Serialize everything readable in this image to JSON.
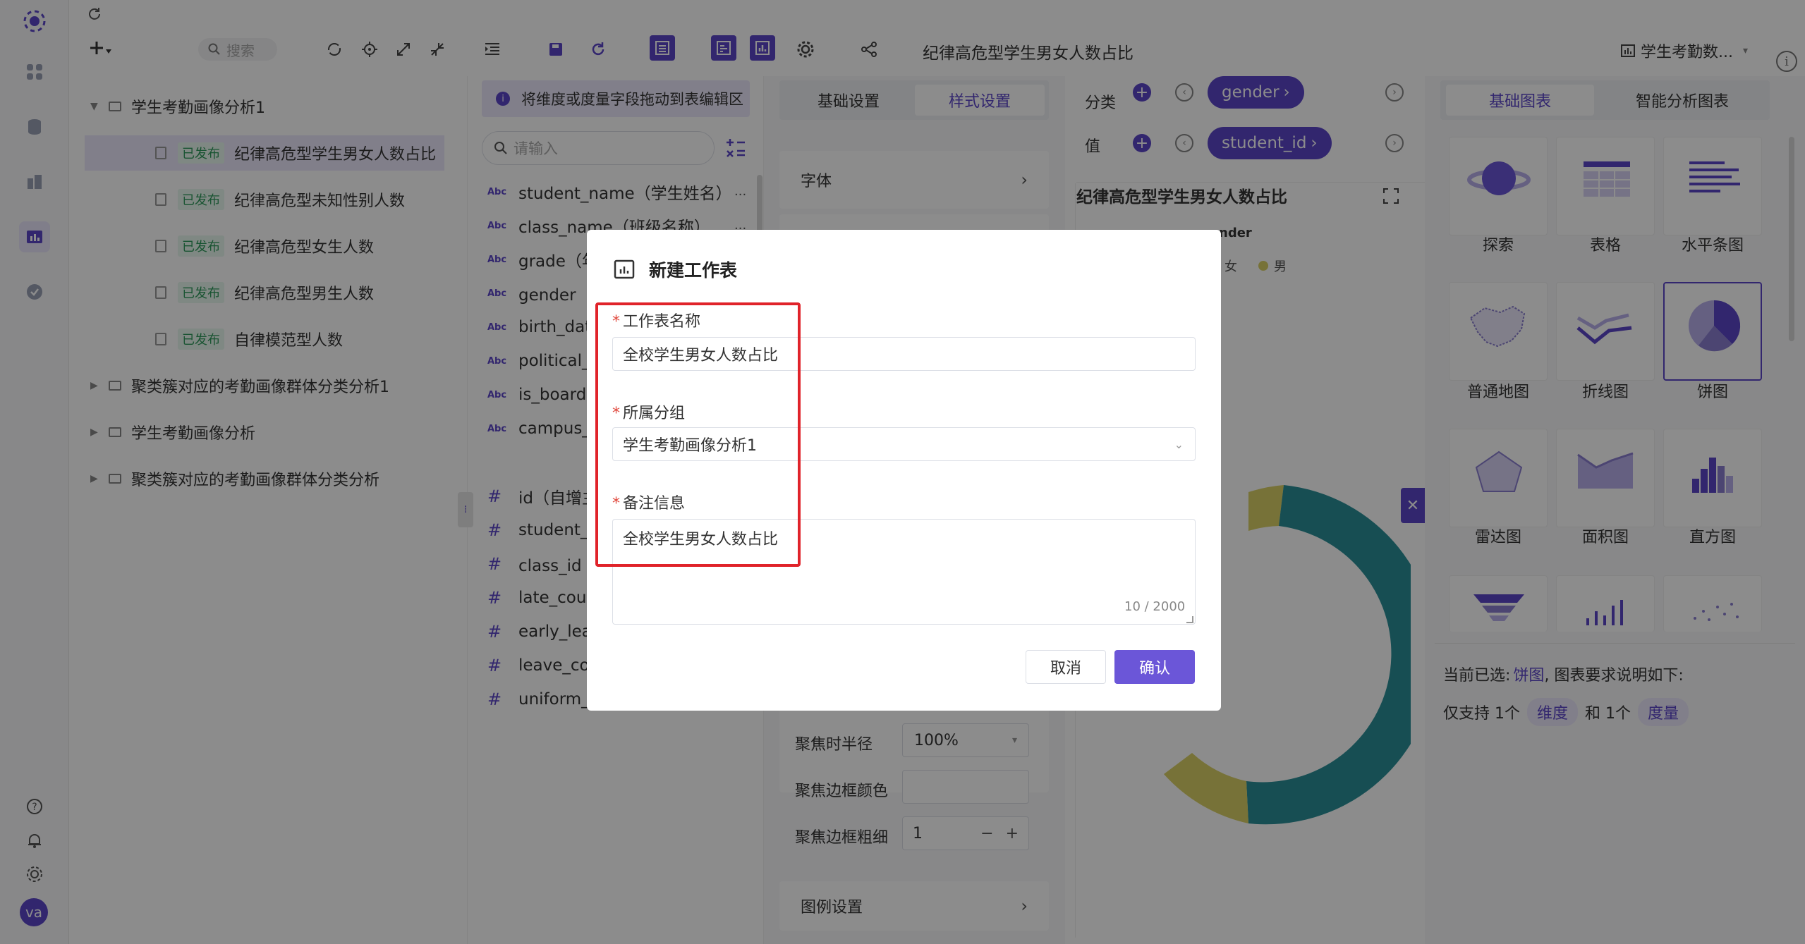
{
  "topbar": {
    "search_placeholder": "搜索",
    "sheet_title": "纪律高危型学生男女人数占比",
    "dataset_name": "学生考勤数..."
  },
  "tree": {
    "root": "学生考勤画像分析1",
    "badge": "已发布",
    "children": [
      "纪律高危型学生男女人数占比",
      "纪律高危型未知性别人数",
      "纪律高危型女生人数",
      "纪律高危型男生人数",
      "自律模范型人数"
    ],
    "folders": [
      "聚类簇对应的考勤画像群体分类分析1",
      "学生考勤画像分析",
      "聚类簇对应的考勤画像群体分类分析"
    ]
  },
  "fields": {
    "hint": "将维度或度量字段拖动到表编辑区",
    "search_placeholder": "请输入",
    "dimensions": [
      "student_name（学生姓名）",
      "class_name（班级名称）",
      "grade（年级）",
      "gender（性别）",
      "birth_date",
      "political_st",
      "is_boarder",
      "campus_ty"
    ],
    "measures": [
      "id（自增主",
      "student_id",
      "class_id（",
      "late_count",
      "early_leave",
      "leave_cour",
      "uniform_vi"
    ],
    "more": "···"
  },
  "settings": {
    "tab_basic": "基础设置",
    "tab_style": "样式设置",
    "font_label": "字体",
    "focus_radius_label": "聚焦时半径",
    "focus_radius_value": "100%",
    "focus_border_color_label": "聚焦边框颜色",
    "focus_border_width_label": "聚焦边框粗细",
    "focus_border_width_value": "1",
    "legend_label": "图例设置"
  },
  "chart_area": {
    "category_label": "分类",
    "value_label": "值",
    "category_pill": "gender",
    "value_pill": "student_id",
    "chart_title": "纪律高危型学生男女人数占比",
    "legend_title": "nder",
    "legend_female": "女",
    "legend_male": "男"
  },
  "chart_types": {
    "tab_basic": "基础图表",
    "tab_smart": "智能分析图表",
    "items": [
      "探索",
      "表格",
      "水平条图",
      "普通地图",
      "折线图",
      "饼图",
      "雷达图",
      "面积图",
      "直方图"
    ],
    "current_selected_prefix": "当前已选:",
    "current_selected": "饼图",
    "requirement_suffix": ", 图表要求说明如下:",
    "only_support": "仅支持 1个",
    "dimension_tag": "维度",
    "and_one": "和 1个",
    "measure_tag": "度量"
  },
  "dialog": {
    "title": "新建工作表",
    "name_label": "工作表名称",
    "name_value": "全校学生男女人数占比",
    "group_label": "所属分组",
    "group_value": "学生考勤画像分析1",
    "remark_label": "备注信息",
    "remark_value": "全校学生男女人数占比",
    "char_count": "10 / 2000",
    "cancel": "取消",
    "confirm": "确认"
  },
  "user": {
    "avatar_text": "va"
  },
  "colors": {
    "primary": "#5b45c9",
    "highlight": "#e0232a",
    "pie_teal": "#2a8f97",
    "pie_yellow": "#d9cf66"
  }
}
